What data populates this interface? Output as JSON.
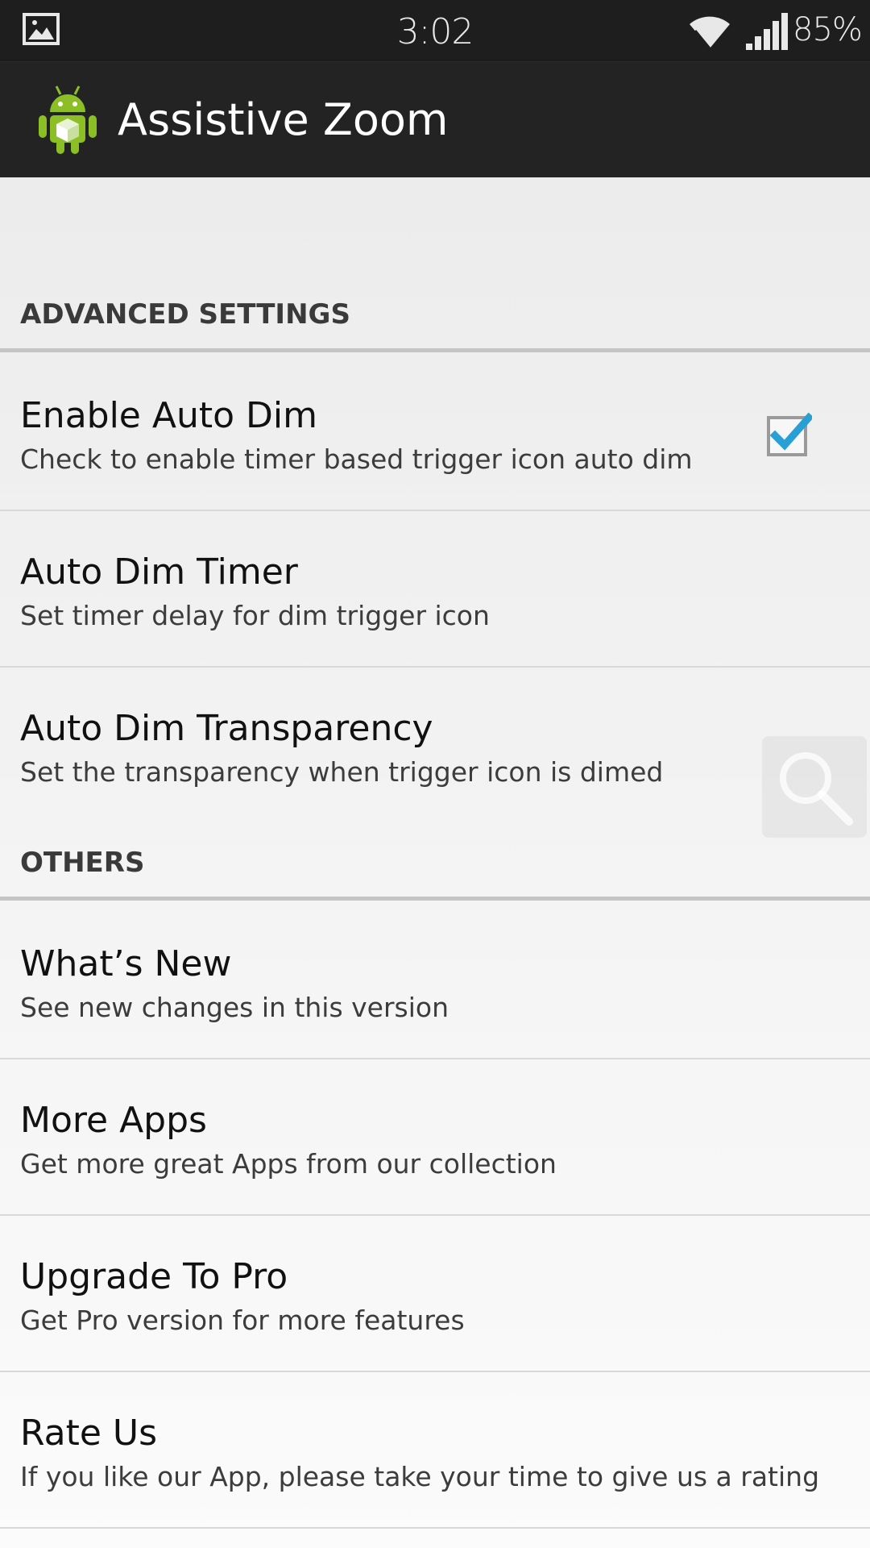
{
  "status_bar": {
    "time": "3:02",
    "battery": "85%",
    "left_icon": "image-notification-icon",
    "wifi_icon": "wifi-icon",
    "signal_icon": "signal-icon"
  },
  "action_bar": {
    "title": "Assistive Zoom",
    "icon": "android-app-icon"
  },
  "sections": [
    {
      "header": "ADVANCED SETTINGS",
      "items": [
        {
          "title": "Enable Auto Dim",
          "summary": "Check to enable timer based trigger icon auto dim",
          "checked": true
        },
        {
          "title": "Auto Dim Timer",
          "summary": "Set timer delay for dim trigger icon"
        },
        {
          "title": "Auto Dim Transparency",
          "summary": "Set the transparency when trigger icon is dimed"
        }
      ]
    },
    {
      "header": "OTHERS",
      "items": [
        {
          "title": "What’s New",
          "summary": "See new changes in this version"
        },
        {
          "title": "More Apps",
          "summary": "Get more great Apps from our collection"
        },
        {
          "title": "Upgrade To Pro",
          "summary": "Get Pro version for more features"
        },
        {
          "title": "Rate Us",
          "summary": "If you like our App, please take your time to give us a rating"
        }
      ]
    }
  ],
  "colors": {
    "status_bar_bg": "#1e1e1e",
    "action_bar_bg": "#232323",
    "checkbox_check": "#2a9fd6",
    "section_text": "#3a3a3a"
  },
  "floating_icon": "magnifier-icon"
}
